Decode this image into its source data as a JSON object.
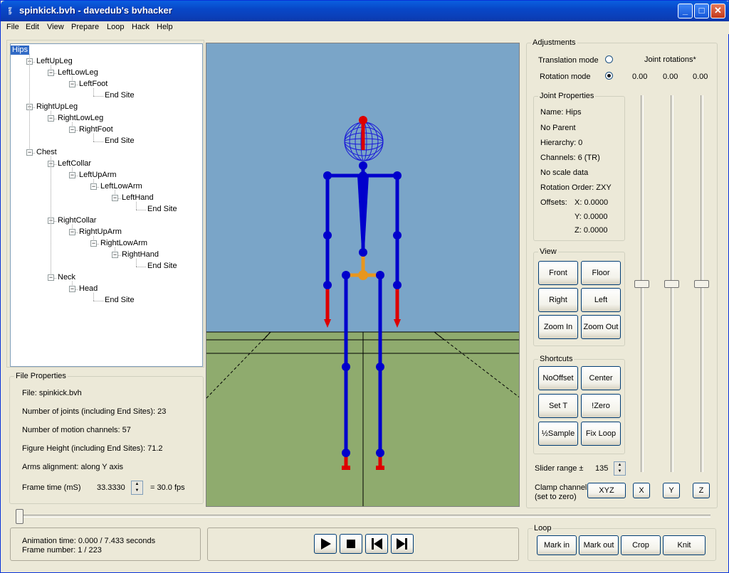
{
  "window": {
    "title": "spinkick.bvh - davedub's bvhacker",
    "icon_text": "bvh"
  },
  "menu": [
    "File",
    "Edit",
    "View",
    "Prepare",
    "Loop",
    "Hack",
    "Help"
  ],
  "tree": [
    {
      "label": "Hips",
      "depth": 0,
      "selected": true
    },
    {
      "label": "LeftUpLeg",
      "depth": 1
    },
    {
      "label": "LeftLowLeg",
      "depth": 2
    },
    {
      "label": "LeftFoot",
      "depth": 3
    },
    {
      "label": "End Site",
      "depth": 4
    },
    {
      "label": "RightUpLeg",
      "depth": 1
    },
    {
      "label": "RightLowLeg",
      "depth": 2
    },
    {
      "label": "RightFoot",
      "depth": 3
    },
    {
      "label": "End Site",
      "depth": 4
    },
    {
      "label": "Chest",
      "depth": 1
    },
    {
      "label": "LeftCollar",
      "depth": 2
    },
    {
      "label": "LeftUpArm",
      "depth": 3
    },
    {
      "label": "LeftLowArm",
      "depth": 4
    },
    {
      "label": "LeftHand",
      "depth": 5
    },
    {
      "label": "End Site",
      "depth": 6
    },
    {
      "label": "RightCollar",
      "depth": 2
    },
    {
      "label": "RightUpArm",
      "depth": 3
    },
    {
      "label": "RightLowArm",
      "depth": 4
    },
    {
      "label": "RightHand",
      "depth": 5
    },
    {
      "label": "End Site",
      "depth": 6
    },
    {
      "label": "Neck",
      "depth": 2
    },
    {
      "label": "Head",
      "depth": 3
    },
    {
      "label": "End Site",
      "depth": 4
    }
  ],
  "file_properties": {
    "title": "File Properties",
    "file": "File: spinkick.bvh",
    "joints": "Number of joints (including End Sites): 23",
    "channels": "Number of motion channels: 57",
    "height": "Figure Height (including End Sites): 71.2",
    "arms": "Arms alignment: along Y axis",
    "frame_time_label": "Frame time (mS)",
    "frame_time_value": "33.3330",
    "fps": "=  30.0 fps"
  },
  "adjustments": {
    "title": "Adjustments",
    "translation_mode": "Translation mode",
    "rotation_mode": "Rotation mode",
    "joint_rotations": "Joint rotations*",
    "rot_x": "0.00",
    "rot_y": "0.00",
    "rot_z": "0.00"
  },
  "joint_properties": {
    "title": "Joint Properties",
    "name": "Name: Hips",
    "parent": "No Parent",
    "hierarchy": "Hierarchy: 0",
    "channels": "Channels: 6 (TR)",
    "scale": "No scale data",
    "rotation_order": "Rotation Order: ZXY",
    "offsets_label": "Offsets:",
    "off_x": "X:  0.0000",
    "off_y": "Y:  0.0000",
    "off_z": "Z:  0.0000"
  },
  "view": {
    "title": "View",
    "front": "Front",
    "floor": "Floor",
    "right": "Right",
    "left": "Left",
    "zoom_in": "Zoom In",
    "zoom_out": "Zoom Out"
  },
  "shortcuts": {
    "title": "Shortcuts",
    "nooffset": "NoOffset",
    "center": "Center",
    "set_t": "Set T",
    "zero": "!Zero",
    "half_sample": "½Sample",
    "fix_loop": "Fix Loop"
  },
  "slider_range": {
    "label": "Slider range ±",
    "value": "135"
  },
  "clamp": {
    "label1": "Clamp channel",
    "label2": "(set to zero)",
    "xyz": "XYZ",
    "x": "X",
    "y": "Y",
    "z": "Z"
  },
  "status": {
    "animation_time": "Animation time: 0.000 / 7.433 seconds",
    "frame_number": "Frame number: 1 / 223"
  },
  "loop": {
    "title": "Loop",
    "mark_in": "Mark in",
    "mark_out": "Mark out",
    "crop": "Crop",
    "knit": "Knit"
  },
  "colors": {
    "sky": "#7aa5c8",
    "floor": "#8fab6e",
    "bone": "#0000cc",
    "end": "#dd0000",
    "root": "#e8961e"
  }
}
